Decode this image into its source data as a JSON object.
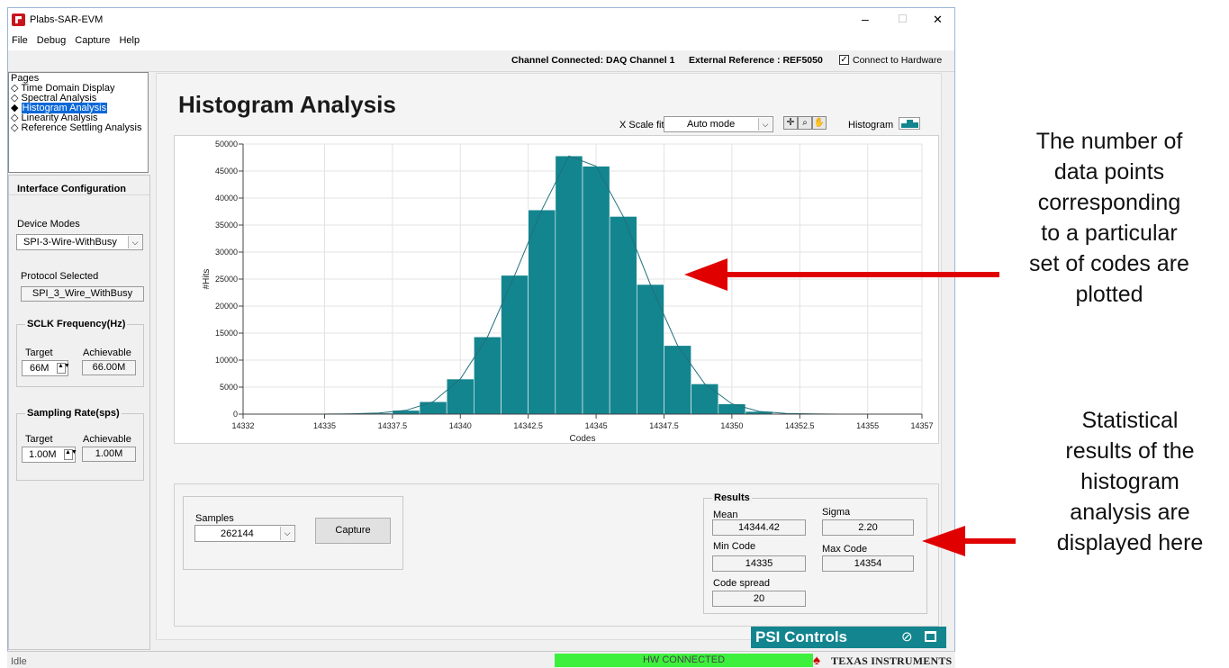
{
  "window": {
    "title": "Plabs-SAR-EVM",
    "controls": {
      "minimize": "–",
      "maximize": "☐",
      "close": "✕"
    }
  },
  "menu": [
    "File",
    "Debug",
    "Capture",
    "Help"
  ],
  "infobar": {
    "channel": "Channel Connected: DAQ Channel 1",
    "reference": "External Reference : REF5050",
    "connect_label": "Connect to Hardware",
    "connect_checked": true
  },
  "pages": {
    "title": "Pages",
    "items": [
      {
        "label": "Time Domain Display",
        "selected": false
      },
      {
        "label": "Spectral Analysis",
        "selected": false
      },
      {
        "label": "Histogram Analysis",
        "selected": true
      },
      {
        "label": "Linearity Analysis",
        "selected": false
      },
      {
        "label": "Reference Settling Analysis",
        "selected": false
      }
    ]
  },
  "interface": {
    "title": "Interface Configuration",
    "device_modes_label": "Device Modes",
    "device_mode": "SPI-3-Wire-WithBusy",
    "protocol_label": "Protocol Selected",
    "protocol": "SPI_3_Wire_WithBusy",
    "sclk": {
      "title": "SCLK Frequency(Hz)",
      "target_label": "Target",
      "achievable_label": "Achievable",
      "target": "66M",
      "achievable": "66.00M"
    },
    "sampling": {
      "title": "Sampling Rate(sps)",
      "target_label": "Target",
      "achievable_label": "Achievable",
      "target": "1.00M",
      "achievable": "1.00M"
    }
  },
  "main": {
    "title": "Histogram Analysis",
    "xscale_label": "X Scale fit",
    "xscale_value": "Auto mode",
    "histogram_label": "Histogram"
  },
  "chart_data": {
    "type": "bar",
    "xlabel": "Codes",
    "ylabel": "#Hits",
    "xlim": [
      14332,
      14357
    ],
    "ylim": [
      0,
      50000
    ],
    "xticks": [
      "14332",
      "14335",
      "14337.5",
      "14340",
      "14342.5",
      "14345",
      "14347.5",
      "14350",
      "14352.5",
      "14355",
      "14357"
    ],
    "yticks": [
      "0",
      "5000",
      "10000",
      "15000",
      "20000",
      "25000",
      "30000",
      "35000",
      "40000",
      "45000",
      "50000"
    ],
    "grid": true,
    "bar_width": 1,
    "x": [
      14335,
      14336,
      14337,
      14338,
      14339,
      14340,
      14341,
      14342,
      14343,
      14344,
      14345,
      14346,
      14347,
      14348,
      14349,
      14350,
      14351,
      14352,
      14353,
      14354
    ],
    "values": [
      20,
      60,
      200,
      700,
      2300,
      6500,
      14300,
      25700,
      37800,
      47800,
      45900,
      36600,
      24000,
      12700,
      5600,
      1900,
      500,
      120,
      40,
      10
    ],
    "color": "#13858f",
    "line_color": "#20707a"
  },
  "capture": {
    "samples_label": "Samples",
    "samples": "262144",
    "capture_label": "Capture"
  },
  "results": {
    "title": "Results",
    "mean_label": "Mean",
    "mean": "14344.42",
    "sigma_label": "Sigma",
    "sigma": "2.20",
    "min_label": "Min Code",
    "min": "14335",
    "max_label": "Max Code",
    "max": "14354",
    "spread_label": "Code spread",
    "spread": "20"
  },
  "psi": {
    "label": "PSI Controls",
    "color": "#13858f"
  },
  "status": {
    "left": "Idle",
    "hw": "HW CONNECTED",
    "hw_color": "#3df03d",
    "brand": "TEXAS INSTRUMENTS",
    "brand_color": "#cc0000"
  },
  "annotations": {
    "plot_note": [
      "The number of",
      "data points",
      "corresponding",
      "to a particular",
      "set of codes are",
      "plotted"
    ],
    "results_note": [
      "Statistical",
      "results of the",
      "histogram",
      "analysis are",
      "displayed here"
    ],
    "arrow_color": "#e00000"
  }
}
